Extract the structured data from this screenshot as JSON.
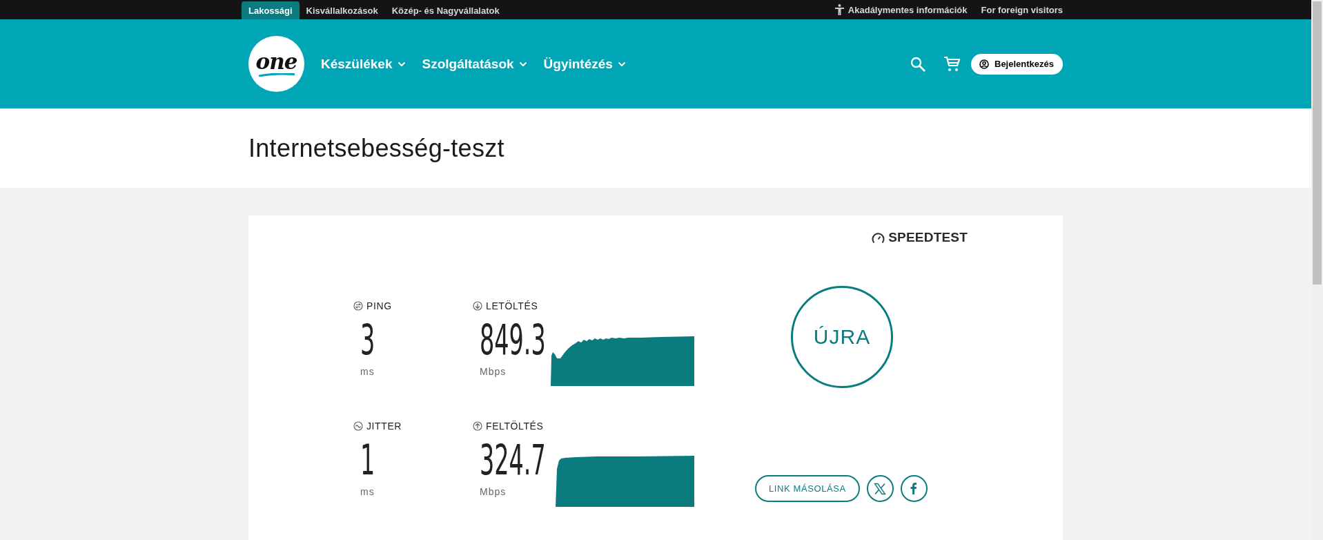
{
  "top_bar": {
    "segments": [
      {
        "label": "Lakossági",
        "selected": true
      },
      {
        "label": "Kisvállalkozások",
        "selected": false
      },
      {
        "label": "Közép- és Nagyvállalatok",
        "selected": false
      }
    ],
    "links": [
      {
        "kind": "accessibility",
        "label": "Akadálymentes információk"
      },
      {
        "kind": "plain",
        "label": "For foreign visitors"
      }
    ]
  },
  "header": {
    "logo": "one",
    "nav": [
      {
        "label": "Készülékek"
      },
      {
        "label": "Szolgáltatások"
      },
      {
        "label": "Ügyintézés"
      }
    ],
    "login_button": "Bejelentkezés"
  },
  "page_title": "Internetsebesség-teszt",
  "speedtest": {
    "brand": "SPEEDTEST",
    "metrics": [
      {
        "kind": "ping",
        "label": "PING",
        "value": "3",
        "unit": "ms"
      },
      {
        "kind": "download",
        "label": "LETÖLTÉS",
        "value": "849.3",
        "unit": "Mbps"
      },
      {
        "kind": "jitter",
        "label": "JITTER",
        "value": "1",
        "unit": "ms"
      },
      {
        "kind": "upload",
        "label": "FELTÖLTÉS",
        "value": "324.7",
        "unit": "Mbps"
      }
    ],
    "restart_button": "ÚJRA",
    "copy_link_button": "LINK MÁSOLÁSA"
  }
}
